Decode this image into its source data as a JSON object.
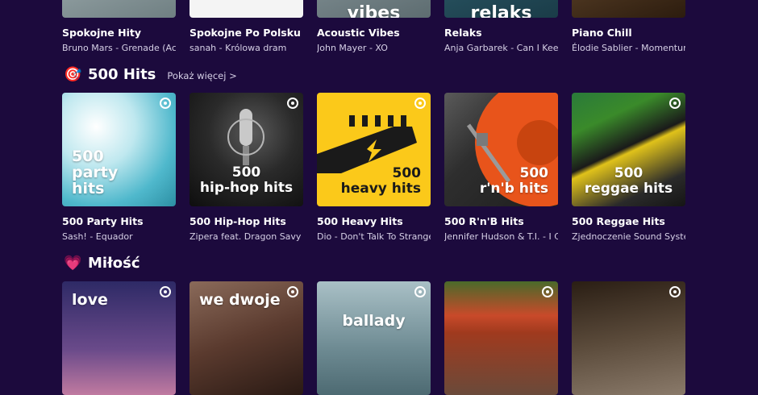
{
  "top_row": [
    {
      "title": "Spokojne Hity",
      "sub": "Bruno Mars - Grenade (Acou",
      "art_text": "",
      "colors": [
        "#a9b6b8",
        "#6f7f82"
      ]
    },
    {
      "title": "Spokojne Po Polsku",
      "sub": "sanah - Królowa dram",
      "art_text": "",
      "colors": [
        "#c5272b",
        "#e04346"
      ]
    },
    {
      "title": "Acoustic Vibes",
      "sub": "John Mayer - XO",
      "art_text": "vibes",
      "colors": [
        "#8a9aa0",
        "#5d6c70"
      ]
    },
    {
      "title": "Relaks",
      "sub": "Anja Garbarek - Can I Keep I",
      "art_text": "relaks",
      "colors": [
        "#2b5a6a",
        "#1a3c48"
      ]
    },
    {
      "title": "Piano Chill",
      "sub": "Élodie Sablier - Momentum",
      "art_text": "",
      "colors": [
        "#6a4a2a",
        "#3b2814"
      ]
    }
  ],
  "sections": [
    {
      "icon": "🎯",
      "heading": "500 Hits",
      "more": "Pokaż więcej >",
      "cards": [
        {
          "title": "500 Party Hits",
          "sub": "Sash! - Equador",
          "art_text": "500 party hits",
          "colors": [
            "#d8eef3",
            "#6fc7d8"
          ]
        },
        {
          "title": "500 Hip-Hop Hits",
          "sub": "Zipera feat. Dragon Savy & T",
          "art_text": "500 hip-hop hits",
          "colors": [
            "#2e2e2e",
            "#0e0e0e"
          ]
        },
        {
          "title": "500 Heavy Hits",
          "sub": "Dio - Don't Talk To Strangers",
          "art_text": "500 heavy hits",
          "colors": [
            "#fbc91a",
            "#f1b400"
          ]
        },
        {
          "title": "500 R'n'B Hits",
          "sub": "Jennifer Hudson & T.I. - I Ca",
          "art_text": "500 r'n'b hits",
          "colors": [
            "#e8541b",
            "#3a3a3a"
          ]
        },
        {
          "title": "500 Reggae Hits",
          "sub": "Zjednoczenie Sound System",
          "art_text": "500 reggae hits",
          "colors": [
            "#1f8a3a",
            "#e0c21a"
          ]
        }
      ]
    },
    {
      "icon": "💗",
      "heading": "Miłość",
      "more": "",
      "cards": [
        {
          "title": "",
          "sub": "",
          "art_text": "love",
          "colors": [
            "#3a2a6a",
            "#8a4a8a"
          ]
        },
        {
          "title": "",
          "sub": "",
          "art_text": "we dwoje",
          "colors": [
            "#7a5a4a",
            "#3a2a22"
          ]
        },
        {
          "title": "",
          "sub": "",
          "art_text": "ballady",
          "colors": [
            "#8aa8b0",
            "#4d6a72"
          ]
        },
        {
          "title": "",
          "sub": "",
          "art_text": "",
          "colors": [
            "#c94a2a",
            "#3a4a1a"
          ]
        },
        {
          "title": "",
          "sub": "",
          "art_text": "",
          "colors": [
            "#3a2a1a",
            "#6a5a4a"
          ]
        }
      ]
    }
  ]
}
